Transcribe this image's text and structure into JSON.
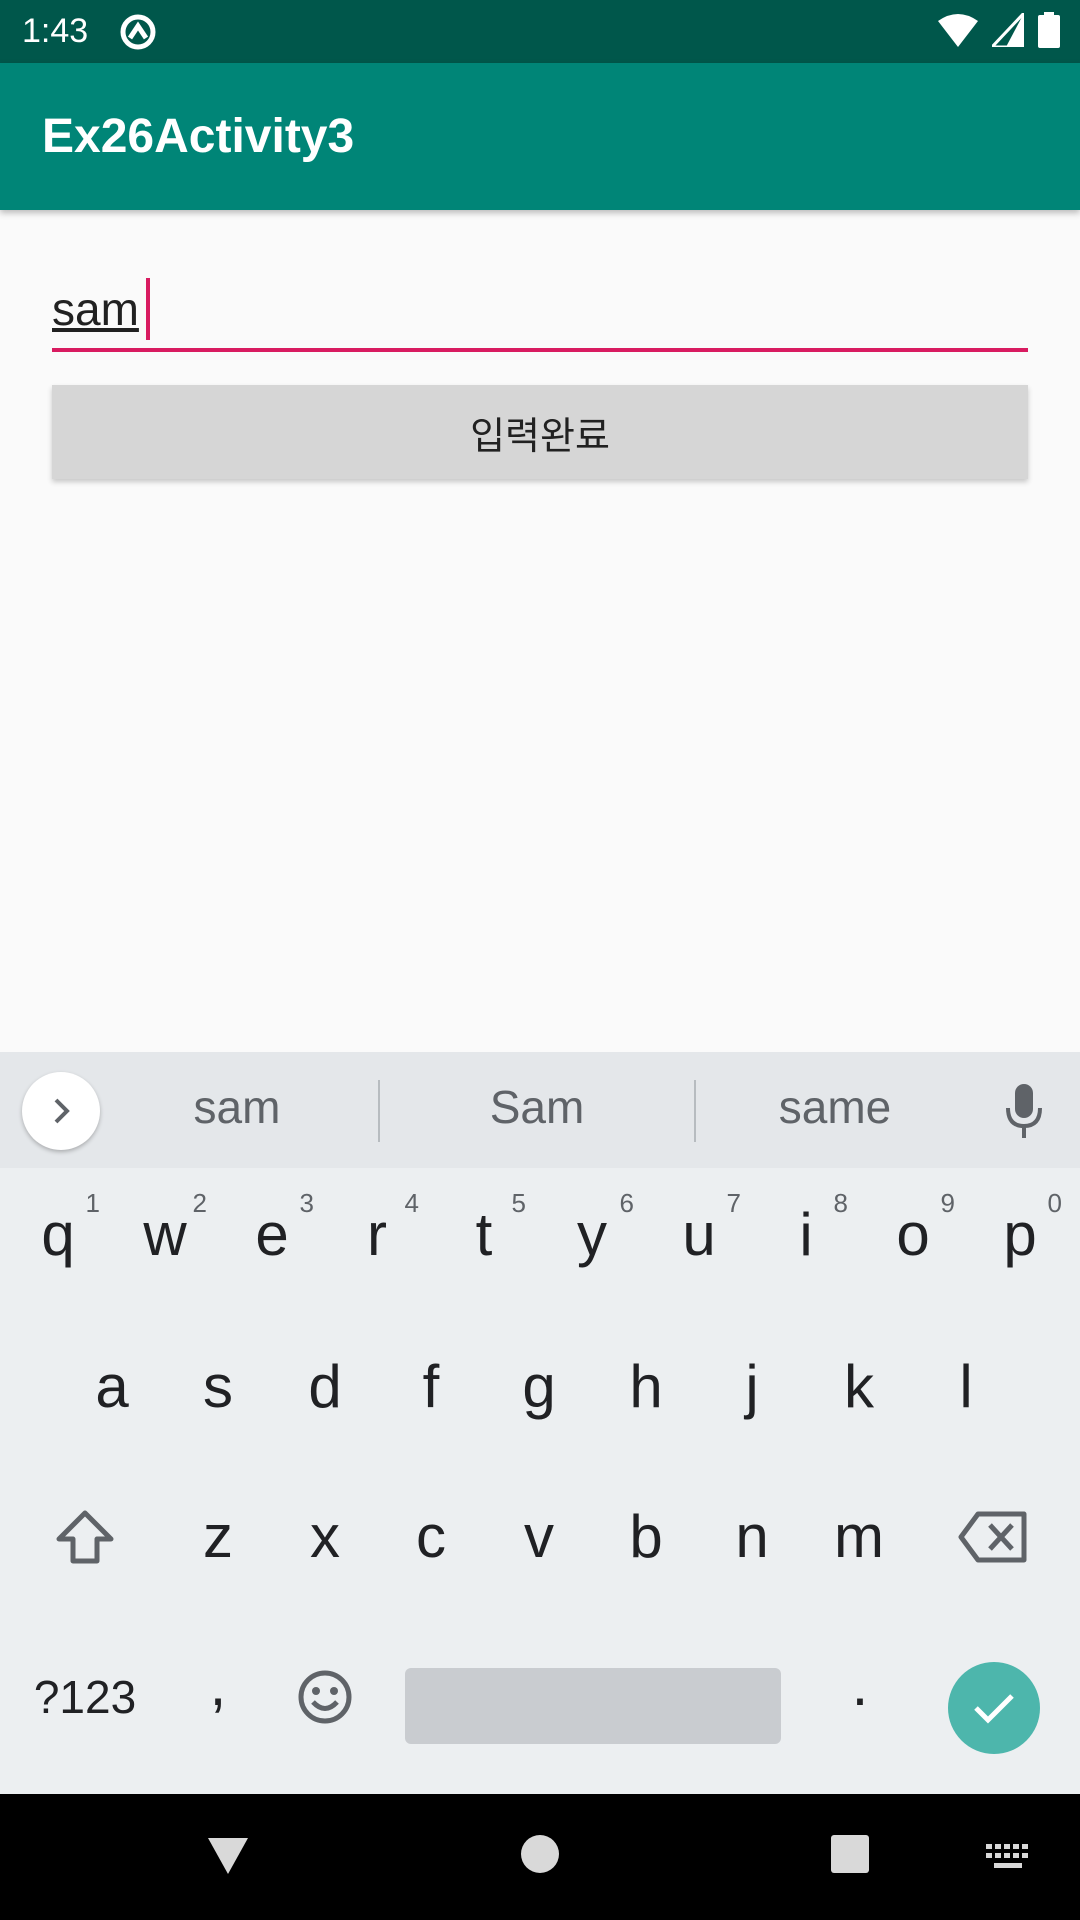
{
  "status_bar": {
    "time": "1:43"
  },
  "app_bar": {
    "title": "Ex26Activity3"
  },
  "form": {
    "input_value": "sam",
    "button_label": "입력완료"
  },
  "keyboard": {
    "suggestions": [
      "sam",
      "Sam",
      "same"
    ],
    "row1": [
      {
        "k": "q",
        "h": "1"
      },
      {
        "k": "w",
        "h": "2"
      },
      {
        "k": "e",
        "h": "3"
      },
      {
        "k": "r",
        "h": "4"
      },
      {
        "k": "t",
        "h": "5"
      },
      {
        "k": "y",
        "h": "6"
      },
      {
        "k": "u",
        "h": "7"
      },
      {
        "k": "i",
        "h": "8"
      },
      {
        "k": "o",
        "h": "9"
      },
      {
        "k": "p",
        "h": "0"
      }
    ],
    "row2": [
      "a",
      "s",
      "d",
      "f",
      "g",
      "h",
      "j",
      "k",
      "l"
    ],
    "row3": [
      "z",
      "x",
      "c",
      "v",
      "b",
      "n",
      "m"
    ],
    "symbols_label": "?123",
    "comma": ",",
    "period": ".",
    "icons": [
      "chevron-right-icon",
      "mic-icon",
      "shift-icon",
      "backspace-icon",
      "emoji-icon",
      "checkmark-icon"
    ]
  },
  "colors": {
    "status_bar": "#00574b",
    "app_bar": "#008577",
    "accent": "#d81b60",
    "enter_key": "#4db6ac"
  }
}
